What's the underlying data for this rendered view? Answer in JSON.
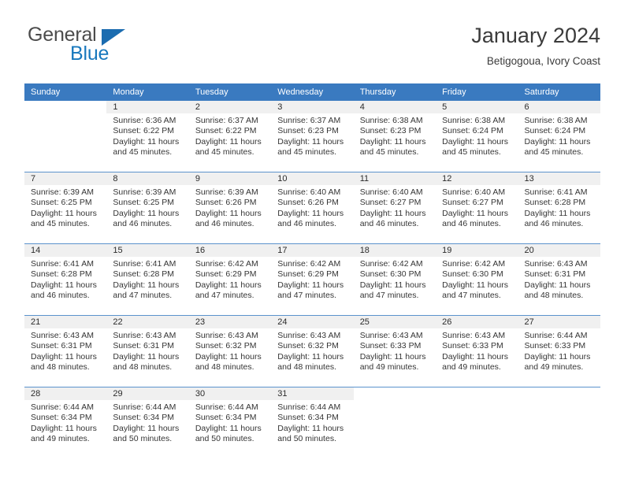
{
  "brand": {
    "name_part1": "General",
    "name_part2": "Blue",
    "flag_icon": "triangle-flag-icon"
  },
  "header": {
    "title": "January 2024",
    "subtitle": "Betigogoua, Ivory Coast"
  },
  "colors": {
    "header_blue": "#3a7ac0",
    "separator_blue": "#5b93cc",
    "daynum_band": "#f0f0f0",
    "brand_blue": "#1878bd",
    "text": "#353535"
  },
  "weekday_headers": [
    "Sunday",
    "Monday",
    "Tuesday",
    "Wednesday",
    "Thursday",
    "Friday",
    "Saturday"
  ],
  "weeks": [
    [
      {
        "day": "",
        "lines": []
      },
      {
        "day": "1",
        "lines": [
          "Sunrise: 6:36 AM",
          "Sunset: 6:22 PM",
          "Daylight: 11 hours",
          "and 45 minutes."
        ]
      },
      {
        "day": "2",
        "lines": [
          "Sunrise: 6:37 AM",
          "Sunset: 6:22 PM",
          "Daylight: 11 hours",
          "and 45 minutes."
        ]
      },
      {
        "day": "3",
        "lines": [
          "Sunrise: 6:37 AM",
          "Sunset: 6:23 PM",
          "Daylight: 11 hours",
          "and 45 minutes."
        ]
      },
      {
        "day": "4",
        "lines": [
          "Sunrise: 6:38 AM",
          "Sunset: 6:23 PM",
          "Daylight: 11 hours",
          "and 45 minutes."
        ]
      },
      {
        "day": "5",
        "lines": [
          "Sunrise: 6:38 AM",
          "Sunset: 6:24 PM",
          "Daylight: 11 hours",
          "and 45 minutes."
        ]
      },
      {
        "day": "6",
        "lines": [
          "Sunrise: 6:38 AM",
          "Sunset: 6:24 PM",
          "Daylight: 11 hours",
          "and 45 minutes."
        ]
      }
    ],
    [
      {
        "day": "7",
        "lines": [
          "Sunrise: 6:39 AM",
          "Sunset: 6:25 PM",
          "Daylight: 11 hours",
          "and 45 minutes."
        ]
      },
      {
        "day": "8",
        "lines": [
          "Sunrise: 6:39 AM",
          "Sunset: 6:25 PM",
          "Daylight: 11 hours",
          "and 46 minutes."
        ]
      },
      {
        "day": "9",
        "lines": [
          "Sunrise: 6:39 AM",
          "Sunset: 6:26 PM",
          "Daylight: 11 hours",
          "and 46 minutes."
        ]
      },
      {
        "day": "10",
        "lines": [
          "Sunrise: 6:40 AM",
          "Sunset: 6:26 PM",
          "Daylight: 11 hours",
          "and 46 minutes."
        ]
      },
      {
        "day": "11",
        "lines": [
          "Sunrise: 6:40 AM",
          "Sunset: 6:27 PM",
          "Daylight: 11 hours",
          "and 46 minutes."
        ]
      },
      {
        "day": "12",
        "lines": [
          "Sunrise: 6:40 AM",
          "Sunset: 6:27 PM",
          "Daylight: 11 hours",
          "and 46 minutes."
        ]
      },
      {
        "day": "13",
        "lines": [
          "Sunrise: 6:41 AM",
          "Sunset: 6:28 PM",
          "Daylight: 11 hours",
          "and 46 minutes."
        ]
      }
    ],
    [
      {
        "day": "14",
        "lines": [
          "Sunrise: 6:41 AM",
          "Sunset: 6:28 PM",
          "Daylight: 11 hours",
          "and 46 minutes."
        ]
      },
      {
        "day": "15",
        "lines": [
          "Sunrise: 6:41 AM",
          "Sunset: 6:28 PM",
          "Daylight: 11 hours",
          "and 47 minutes."
        ]
      },
      {
        "day": "16",
        "lines": [
          "Sunrise: 6:42 AM",
          "Sunset: 6:29 PM",
          "Daylight: 11 hours",
          "and 47 minutes."
        ]
      },
      {
        "day": "17",
        "lines": [
          "Sunrise: 6:42 AM",
          "Sunset: 6:29 PM",
          "Daylight: 11 hours",
          "and 47 minutes."
        ]
      },
      {
        "day": "18",
        "lines": [
          "Sunrise: 6:42 AM",
          "Sunset: 6:30 PM",
          "Daylight: 11 hours",
          "and 47 minutes."
        ]
      },
      {
        "day": "19",
        "lines": [
          "Sunrise: 6:42 AM",
          "Sunset: 6:30 PM",
          "Daylight: 11 hours",
          "and 47 minutes."
        ]
      },
      {
        "day": "20",
        "lines": [
          "Sunrise: 6:43 AM",
          "Sunset: 6:31 PM",
          "Daylight: 11 hours",
          "and 48 minutes."
        ]
      }
    ],
    [
      {
        "day": "21",
        "lines": [
          "Sunrise: 6:43 AM",
          "Sunset: 6:31 PM",
          "Daylight: 11 hours",
          "and 48 minutes."
        ]
      },
      {
        "day": "22",
        "lines": [
          "Sunrise: 6:43 AM",
          "Sunset: 6:31 PM",
          "Daylight: 11 hours",
          "and 48 minutes."
        ]
      },
      {
        "day": "23",
        "lines": [
          "Sunrise: 6:43 AM",
          "Sunset: 6:32 PM",
          "Daylight: 11 hours",
          "and 48 minutes."
        ]
      },
      {
        "day": "24",
        "lines": [
          "Sunrise: 6:43 AM",
          "Sunset: 6:32 PM",
          "Daylight: 11 hours",
          "and 48 minutes."
        ]
      },
      {
        "day": "25",
        "lines": [
          "Sunrise: 6:43 AM",
          "Sunset: 6:33 PM",
          "Daylight: 11 hours",
          "and 49 minutes."
        ]
      },
      {
        "day": "26",
        "lines": [
          "Sunrise: 6:43 AM",
          "Sunset: 6:33 PM",
          "Daylight: 11 hours",
          "and 49 minutes."
        ]
      },
      {
        "day": "27",
        "lines": [
          "Sunrise: 6:44 AM",
          "Sunset: 6:33 PM",
          "Daylight: 11 hours",
          "and 49 minutes."
        ]
      }
    ],
    [
      {
        "day": "28",
        "lines": [
          "Sunrise: 6:44 AM",
          "Sunset: 6:34 PM",
          "Daylight: 11 hours",
          "and 49 minutes."
        ]
      },
      {
        "day": "29",
        "lines": [
          "Sunrise: 6:44 AM",
          "Sunset: 6:34 PM",
          "Daylight: 11 hours",
          "and 50 minutes."
        ]
      },
      {
        "day": "30",
        "lines": [
          "Sunrise: 6:44 AM",
          "Sunset: 6:34 PM",
          "Daylight: 11 hours",
          "and 50 minutes."
        ]
      },
      {
        "day": "31",
        "lines": [
          "Sunrise: 6:44 AM",
          "Sunset: 6:34 PM",
          "Daylight: 11 hours",
          "and 50 minutes."
        ]
      },
      {
        "day": "",
        "lines": []
      },
      {
        "day": "",
        "lines": []
      },
      {
        "day": "",
        "lines": []
      }
    ]
  ]
}
